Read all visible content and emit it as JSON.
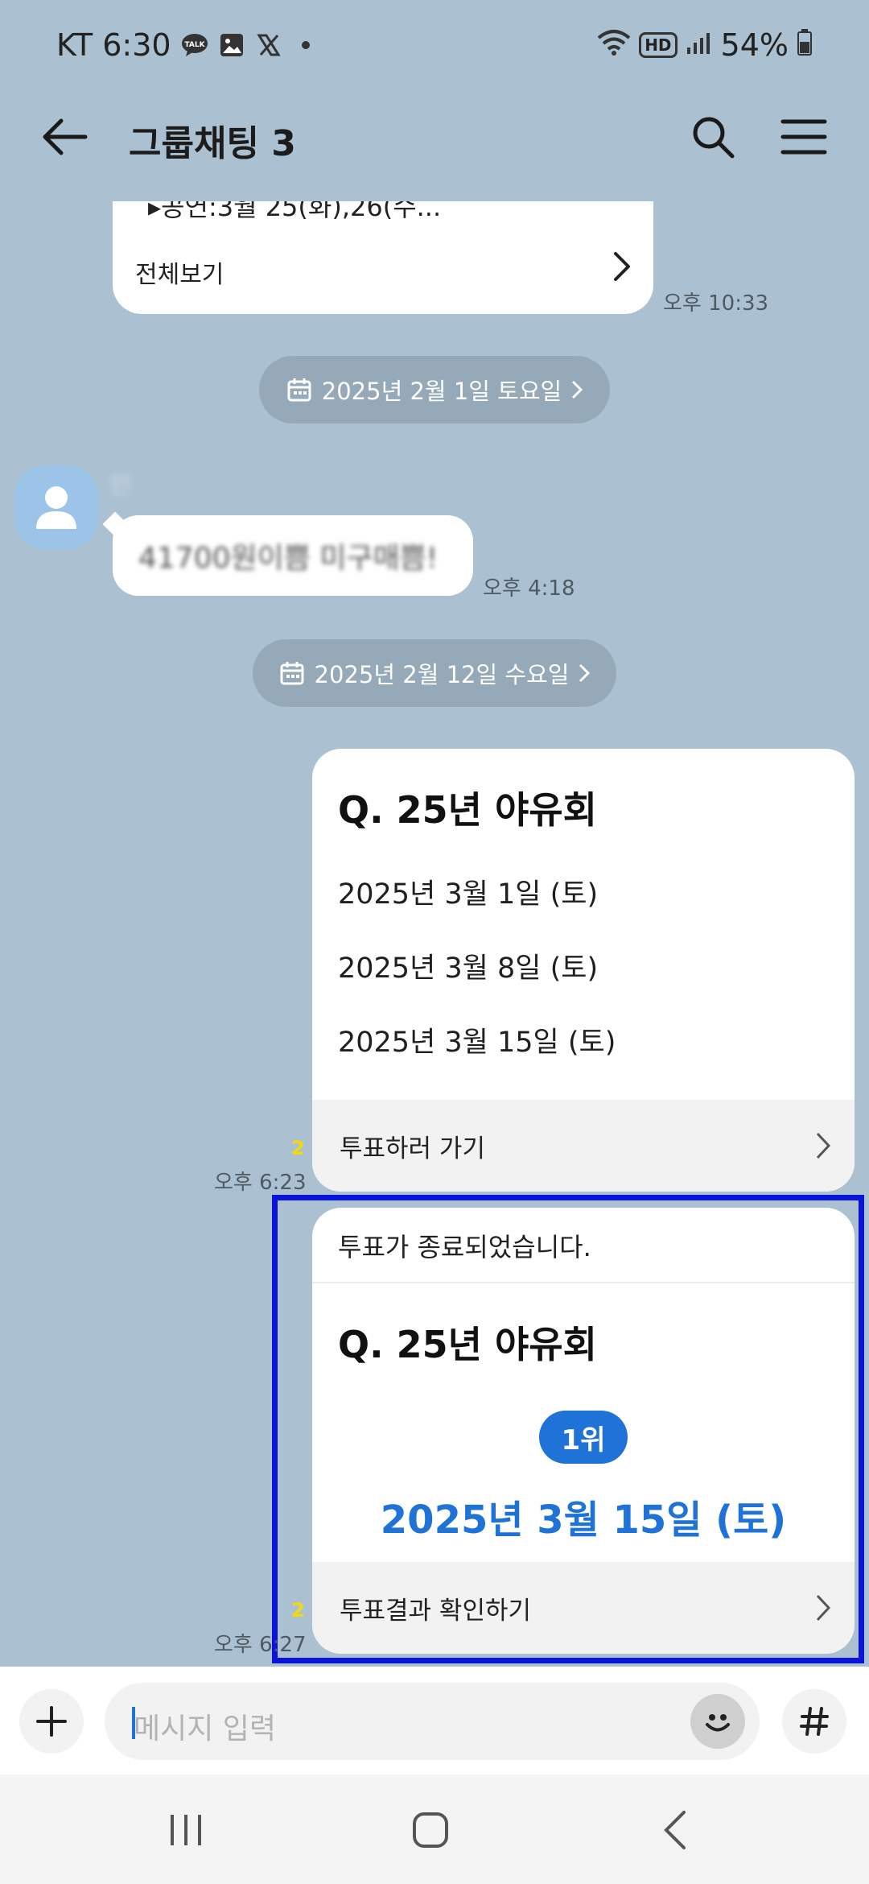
{
  "status": {
    "carrier_time": "KT 6:30",
    "battery": "54%",
    "hd": "HD"
  },
  "header": {
    "title": "그룹채팅 3"
  },
  "top_message": {
    "snippet": "▸공연:3월 25(화),26(수...",
    "view_all": "전체보기",
    "time": "오후 10:33"
  },
  "date_1": "2025년 2월 1일 토요일",
  "incoming": {
    "sender": "민",
    "text": "41700원이쁨 미구매쁨!",
    "time": "오후 4:18"
  },
  "date_2": "2025년 2월 12일 수요일",
  "poll": {
    "title": "Q. 25년 야유회",
    "options": [
      "2025년 3월 1일 (토)",
      "2025년 3월 8일 (토)",
      "2025년 3월 15일 (토)"
    ],
    "footer": "투표하러 가기",
    "unread": "2",
    "time": "오후 6:23"
  },
  "poll_result": {
    "ended": "투표가 종료되었습니다.",
    "title": "Q. 25년 야유회",
    "rank_badge": "1위",
    "winner": "2025년 3월 15일 (토)",
    "footer": "투표결과 확인하기",
    "unread": "2",
    "time": "오후 6:27"
  },
  "input": {
    "placeholder": "메시지 입력"
  },
  "colors": {
    "background": "#abc1d1",
    "accent": "#1f73d6",
    "highlight_box": "#0a14d8",
    "unread": "#f5d90f"
  }
}
